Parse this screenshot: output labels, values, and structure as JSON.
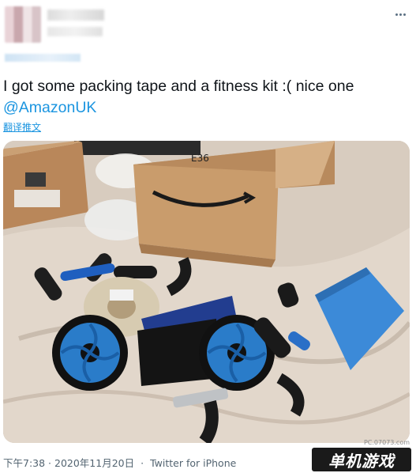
{
  "tweet": {
    "text_before_mention": "I got some packing tape and a fitness kit :( nice one",
    "mention": "@AmazonUK",
    "translate_label": "翻译推文",
    "timestamp": "下午7:38 · 2020年11月20日",
    "separator": "·",
    "source": "Twitter for iPhone"
  },
  "photo": {
    "box_label": "E36",
    "tape_label": "",
    "description_icons": [
      "cardboard-box",
      "packing-tape",
      "ab-roller-wheel",
      "push-up-bar",
      "yoga-mat"
    ]
  },
  "watermark": {
    "url": "PC.07073.com",
    "logo_text": "单机游戏"
  },
  "colors": {
    "link": "#1b95e0",
    "text": "#0f1419",
    "meta": "#536471"
  }
}
